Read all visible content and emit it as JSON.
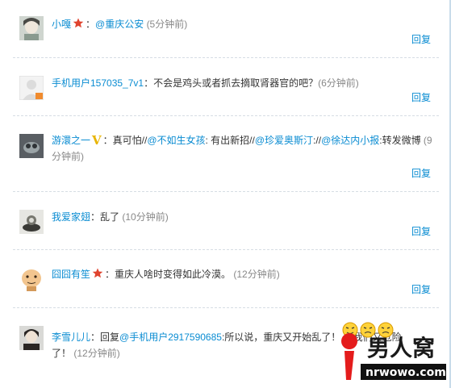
{
  "colors": {
    "link": "#0a8cd2",
    "time": "#888888",
    "text": "#333333"
  },
  "reply_label": "回复",
  "comments": [
    {
      "user": "小嘎",
      "badge": "star-badge-icon",
      "parts": [
        {
          "t": "：",
          "c": "plain"
        },
        {
          "t": "@重庆公安",
          "c": "mention"
        },
        {
          "t": " ",
          "c": "plain"
        },
        {
          "t": "(5分钟前)",
          "c": "time"
        }
      ]
    },
    {
      "user": "手机用户157035_7v1",
      "parts": [
        {
          "t": "：不会是鸡头或者抓去摘取肾器官的吧？",
          "c": "plain"
        },
        {
          "t": "(6分钟前)",
          "c": "time"
        }
      ]
    },
    {
      "user": "游澴之一",
      "vbadge": "V",
      "parts": [
        {
          "t": "：真可怕//",
          "c": "plain"
        },
        {
          "t": "@不如生女孩",
          "c": "mention"
        },
        {
          "t": ": 有出新招//",
          "c": "plain"
        },
        {
          "t": "@珍爱奥斯汀",
          "c": "mention"
        },
        {
          "t": "://",
          "c": "plain"
        },
        {
          "t": "@徐达内小报",
          "c": "mention"
        },
        {
          "t": ":转发微博",
          "c": "plain"
        },
        {
          "t": " (9分钟前)",
          "c": "time"
        }
      ]
    },
    {
      "user": "我爱家翅",
      "parts": [
        {
          "t": "：乱了",
          "c": "plain"
        },
        {
          "t": " (10分钟前)",
          "c": "time"
        }
      ]
    },
    {
      "user": "囧囧有笙",
      "badge": "star-badge-icon",
      "parts": [
        {
          "t": "：重庆人啥时变得如此冷漠。",
          "c": "plain"
        },
        {
          "t": " (12分钟前)",
          "c": "time"
        }
      ]
    },
    {
      "user": "李雪儿儿",
      "parts": [
        {
          "t": "：回复",
          "c": "plain"
        },
        {
          "t": "@手机用户2917590685",
          "c": "mention"
        },
        {
          "t": ":所以说，重庆又开始乱了！",
          "c": "plain"
        },
        {
          "t": "   ，我们又危险了！",
          "c": "plain"
        },
        {
          "t": " (12分钟前)",
          "c": "time"
        }
      ]
    }
  ],
  "watermark": {
    "brand": "男人窝",
    "site": "nrwowo.com"
  }
}
